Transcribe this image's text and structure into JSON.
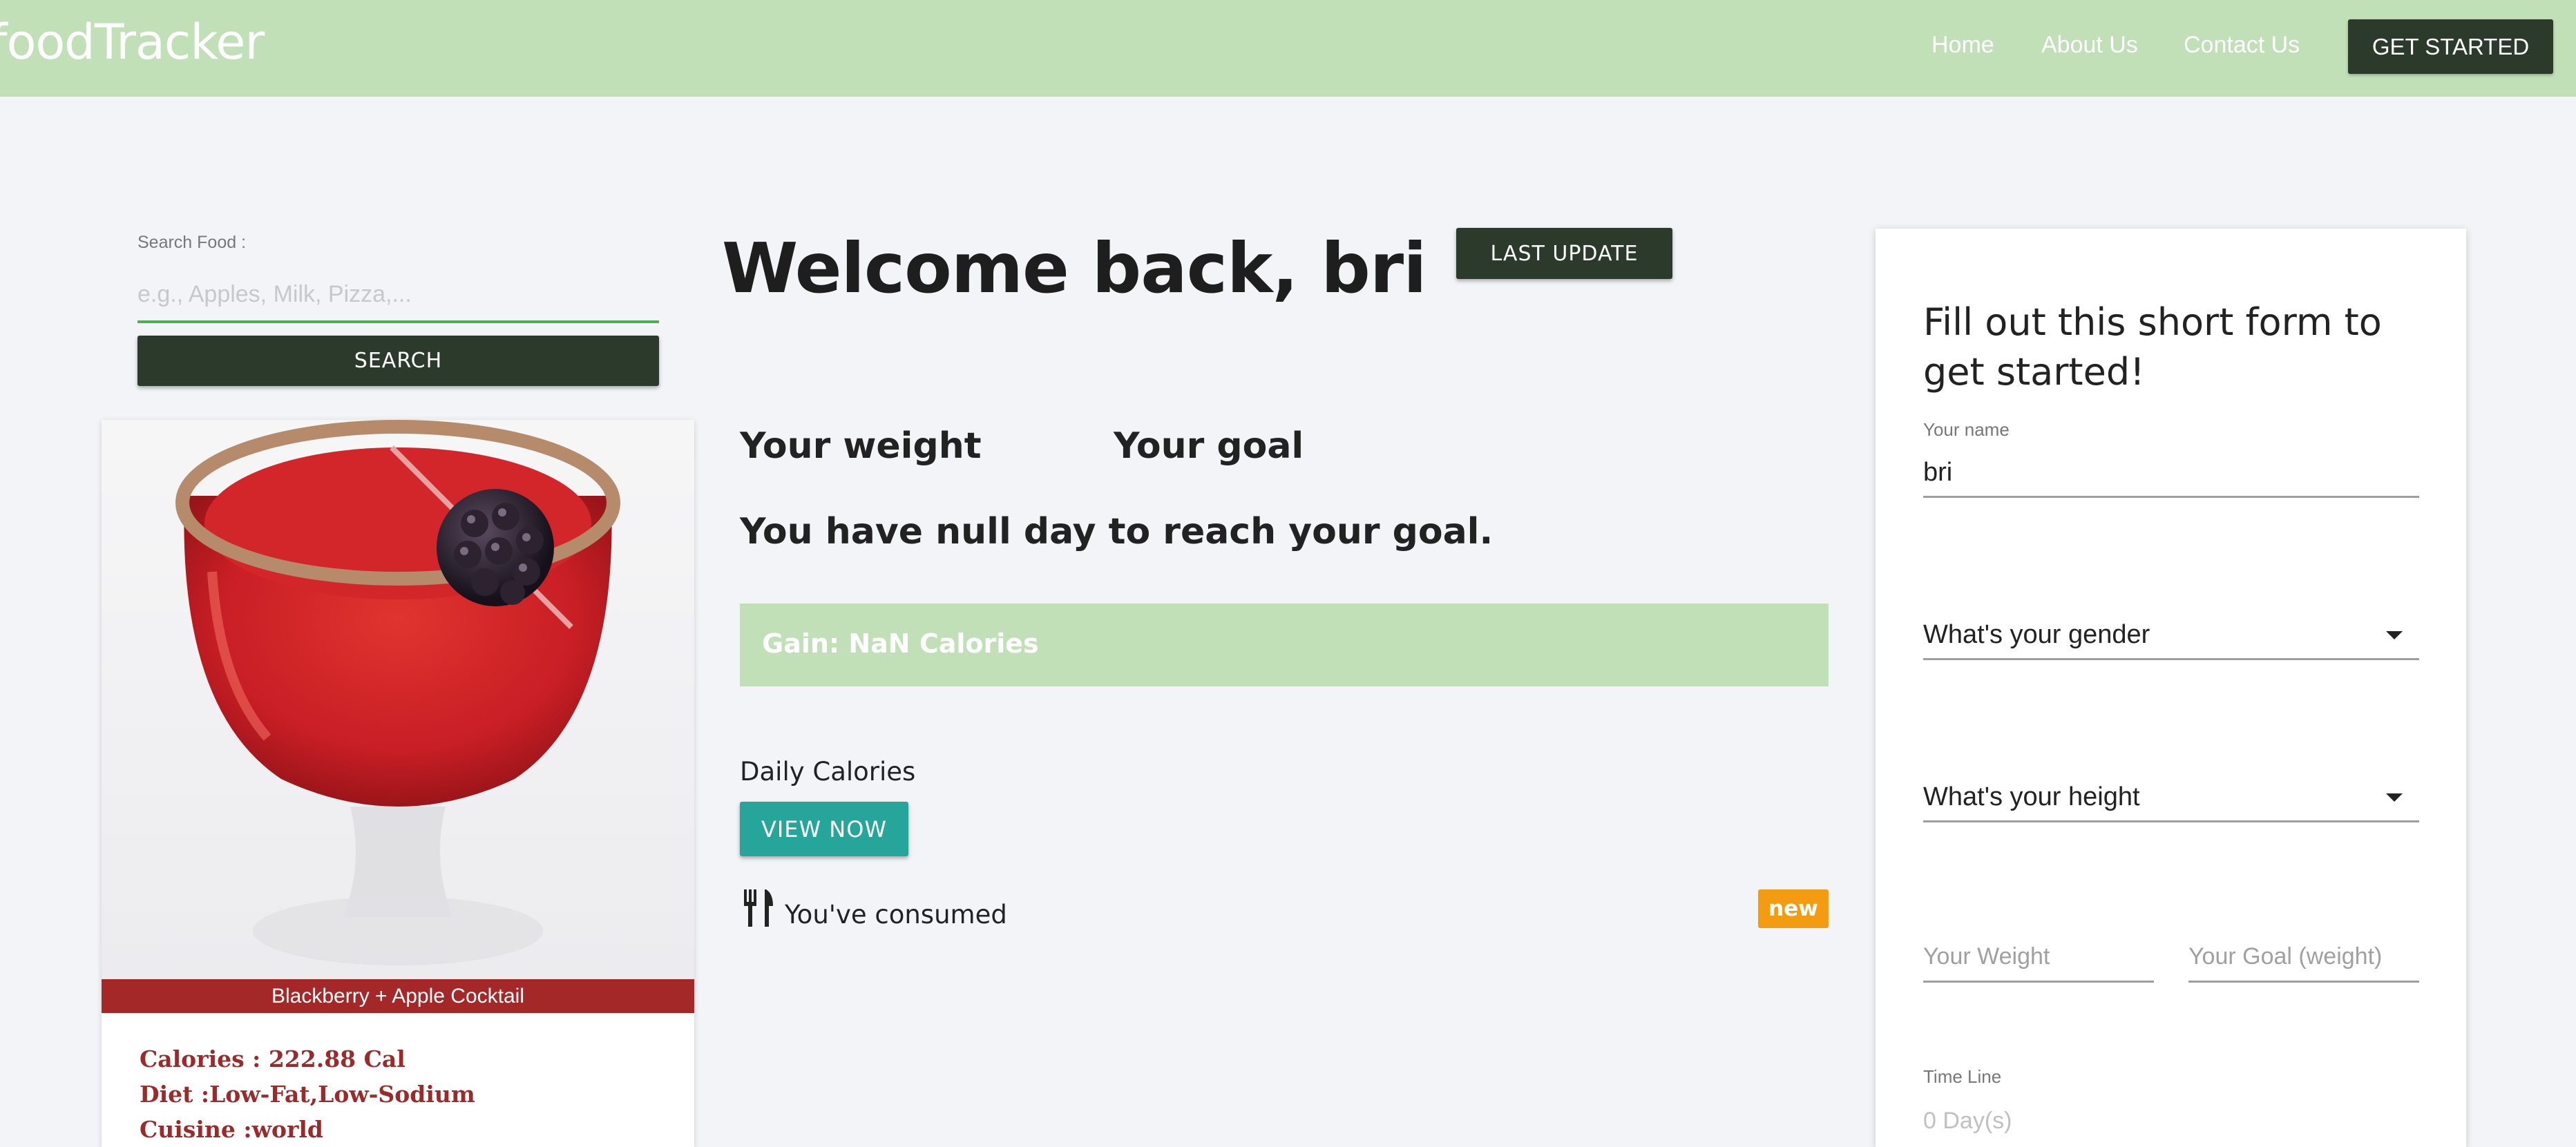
{
  "navbar": {
    "brand": "foodTracker",
    "links": [
      "Home",
      "About Us",
      "Contact Us"
    ],
    "cta_label": "GET STARTED"
  },
  "search": {
    "label": "Search Food :",
    "placeholder": "e.g., Apples, Milk, Pizza,...",
    "button_label": "SEARCH"
  },
  "food_card": {
    "caption": "Blackberry + Apple Cocktail",
    "calories": "Calories : 222.88 Cal",
    "diet": "Diet :Low-Fat,Low-Sodium",
    "cuisine": "Cuisine :world"
  },
  "main": {
    "welcome": "Welcome back, bri",
    "last_update_label": "LAST UPDATE",
    "your_weight": "Your weight",
    "your_goal": "Your goal",
    "reach_goal": "You have null day to reach your goal.",
    "gain_text": "Gain: NaN Calories",
    "daily_calories": "Daily Calories",
    "view_now_label": "VIEW NOW",
    "consumed": "You've consumed",
    "badge": "new"
  },
  "form": {
    "title": "Fill out this short form to get started!",
    "name_label": "Your name",
    "name_value": "bri",
    "gender_select": "What's your gender",
    "height_select": "What's your height",
    "weight_placeholder": "Your Weight",
    "goal_placeholder": "Your Goal (weight)",
    "timeline_label": "Time Line",
    "timeline_placeholder": "0 Day(s)"
  },
  "colors": {
    "navbar_bg": "#c1e0b8",
    "dark_button": "#2b3a2a",
    "teal_button": "#26a69a",
    "caption_red": "#a52828",
    "badge_orange": "#f39c12",
    "page_bg": "#f3f4f8"
  }
}
